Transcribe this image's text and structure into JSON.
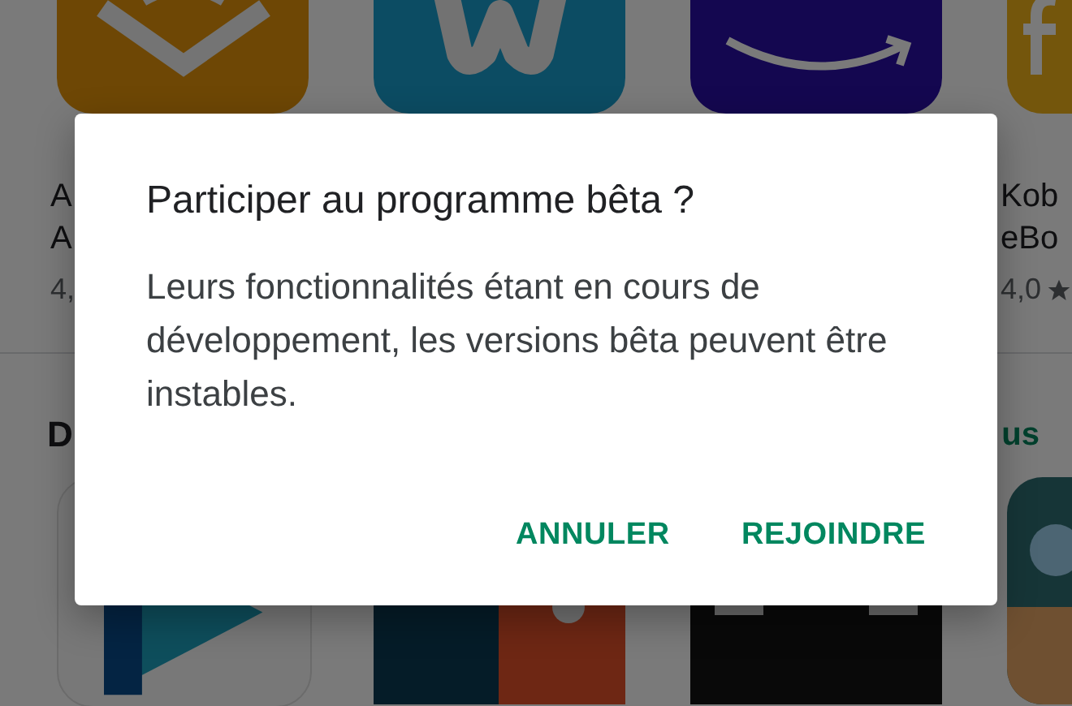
{
  "background": {
    "top_apps": [
      {
        "kind": "book",
        "name_line_1": "A",
        "name_line_2": "A",
        "rating": "4,"
      },
      {
        "kind": "w-logo"
      },
      {
        "kind": "music-logo"
      },
      {
        "kind": "f-logo",
        "name_line_1": "Kob",
        "name_line_2": "eBo",
        "rating": "4,0",
        "rating_star": true
      }
    ],
    "section": {
      "title": "D",
      "more_link": "us"
    },
    "bottom_apps": [
      {
        "kind": "play"
      },
      {
        "kind": "controller"
      },
      {
        "kind": "space-station"
      },
      {
        "kind": "cartoon"
      }
    ]
  },
  "dialog": {
    "title": "Participer au programme bêta ?",
    "message": "Leurs fonctionnalités étant en cours de développement, les versions bêta peuvent être instables.",
    "buttons": [
      "ANNULER",
      "REJOINDRE"
    ]
  }
}
